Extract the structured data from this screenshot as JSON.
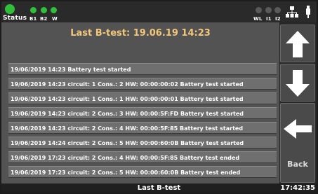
{
  "status_bar": {
    "status_label": "Status",
    "left_indicators": [
      "B1",
      "B2",
      "W"
    ],
    "right_indicators": [
      "WL",
      "I1",
      "I2"
    ],
    "active_color": "#2fbf3a",
    "inactive_color": "#5a5a5a"
  },
  "main": {
    "title": "Last B-test: 19.06.19  14:23",
    "log_rows": [
      "19/06/2019  14:23  Battery test started",
      "19/06/2019  14:23  circuit:  1  Cons.:  2  HW: 00:00:00:02  Battery test started",
      "19/06/2019  14:23  circuit:  1  Cons.:  1  HW: 00:00:00:01  Battery test started",
      "19/06/2019  14:23  circuit:  2  Cons.:  3  HW: 00:00:5F:FD  Battery test started",
      "19/06/2019  14:23  circuit:  2  Cons.:  4  HW: 00:00:5F:85  Battery test started",
      "19/06/2019  14:24  circuit:  2  Cons.:  5  HW: 00:00:60:0B  Battery test started",
      "19/06/2019  17:23  circuit:  2  Cons.:  4  HW: 00:00:5F:85  Battery test ended",
      "19/06/2019  17:23  circuit:  2  Cons.:  5  HW: 00:00:60:0B  Battery test ended"
    ]
  },
  "side_buttons": {
    "up_icon": "arrow-up-icon",
    "down_icon": "arrow-down-icon",
    "back_icon": "arrow-left-icon",
    "back_label": "Back"
  },
  "bottom_bar": {
    "title": "Last B-test",
    "clock": "17:42:35"
  }
}
